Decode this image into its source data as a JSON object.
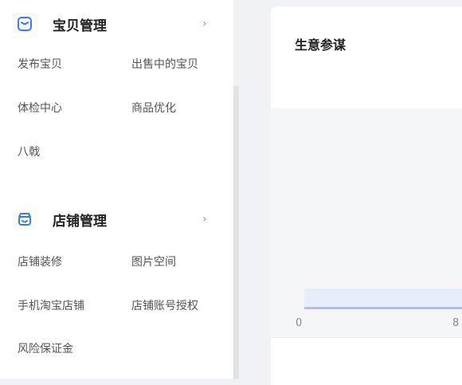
{
  "sidebar": {
    "sections": [
      {
        "icon": "product-icon",
        "title": "宝贝管理",
        "chevron": "›",
        "links": [
          "发布宝贝",
          "出售中的宝贝",
          "体检中心",
          "商品优化",
          "八戟"
        ]
      },
      {
        "icon": "store-icon",
        "title": "店铺管理",
        "chevron": "›",
        "links": [
          "店铺装修",
          "图片空间",
          "手机淘宝店铺",
          "店铺账号授权",
          "风险保证金"
        ]
      }
    ]
  },
  "card": {
    "title": "生意参谋",
    "x_ticks": [
      "0",
      "8"
    ]
  },
  "colors": {
    "accent": "#3a7bf3",
    "chart_line": "#a6c2ee",
    "chart_band": "#e6eefb"
  }
}
